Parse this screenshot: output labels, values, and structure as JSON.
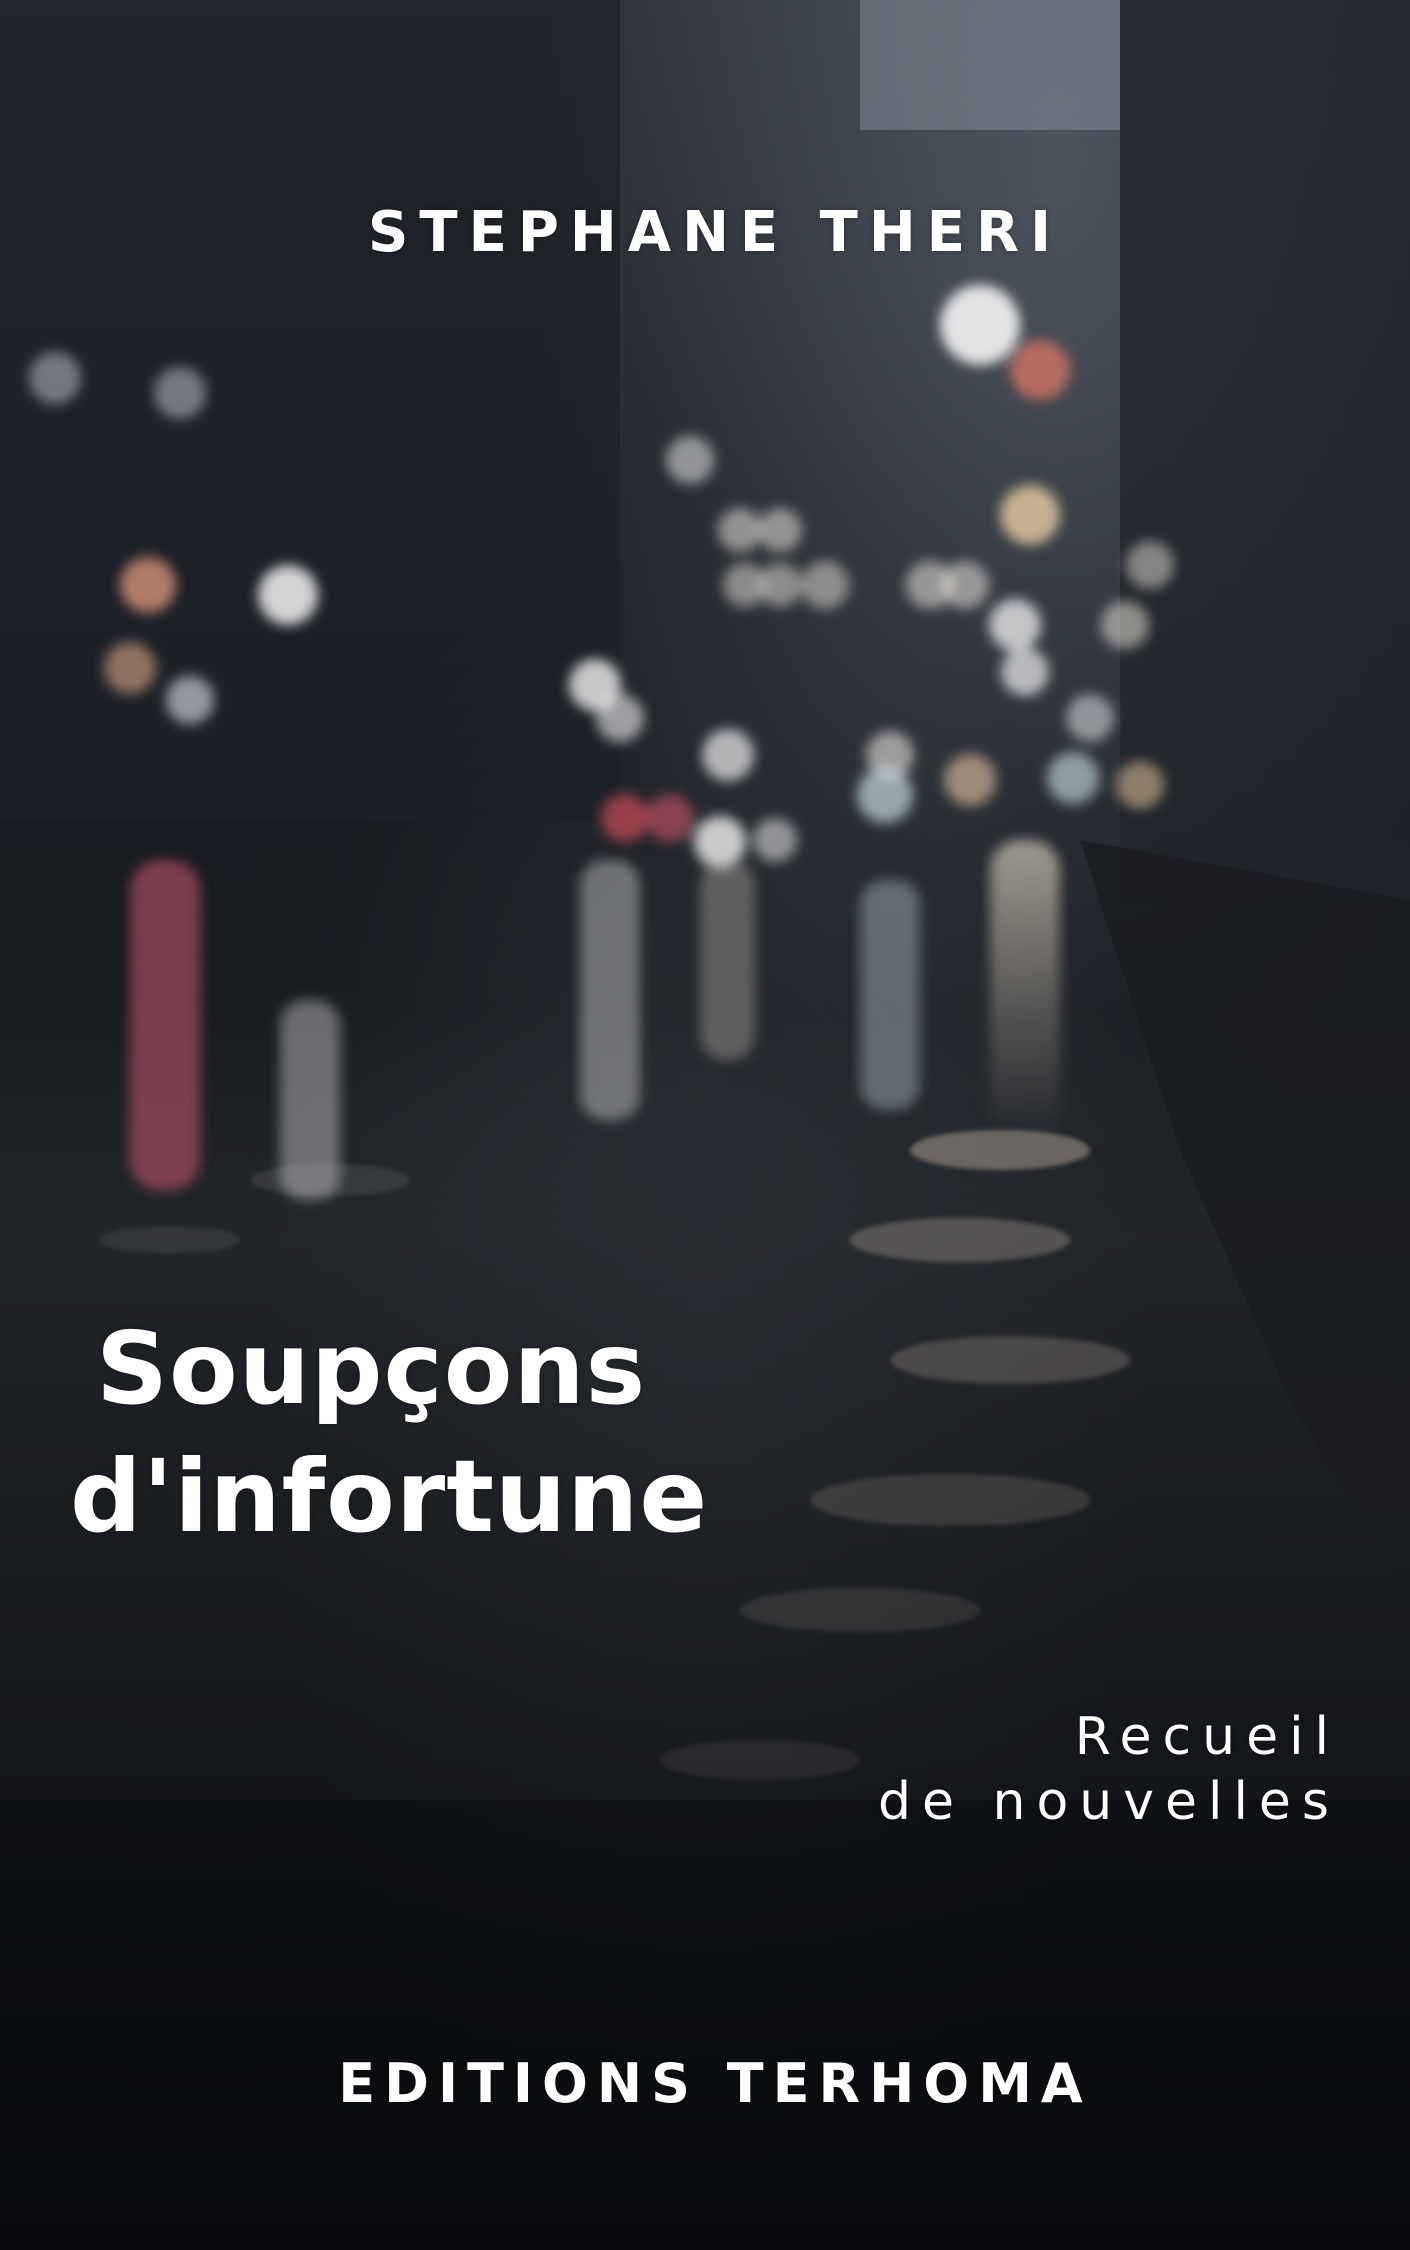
{
  "cover": {
    "author": "STEPHANE THERI",
    "title_line1": "Soupçons",
    "title_line2": "d'infortune",
    "subtitle_line1": "Recueil",
    "subtitle_line2": "de nouvelles",
    "publisher": "EDITIONS TERHOMA"
  },
  "colors": {
    "text": "#ffffff",
    "background": "#15181d",
    "light_warm": "#e8c9a0",
    "light_cool": "#cfd8e0",
    "light_red": "#d0566a"
  }
}
